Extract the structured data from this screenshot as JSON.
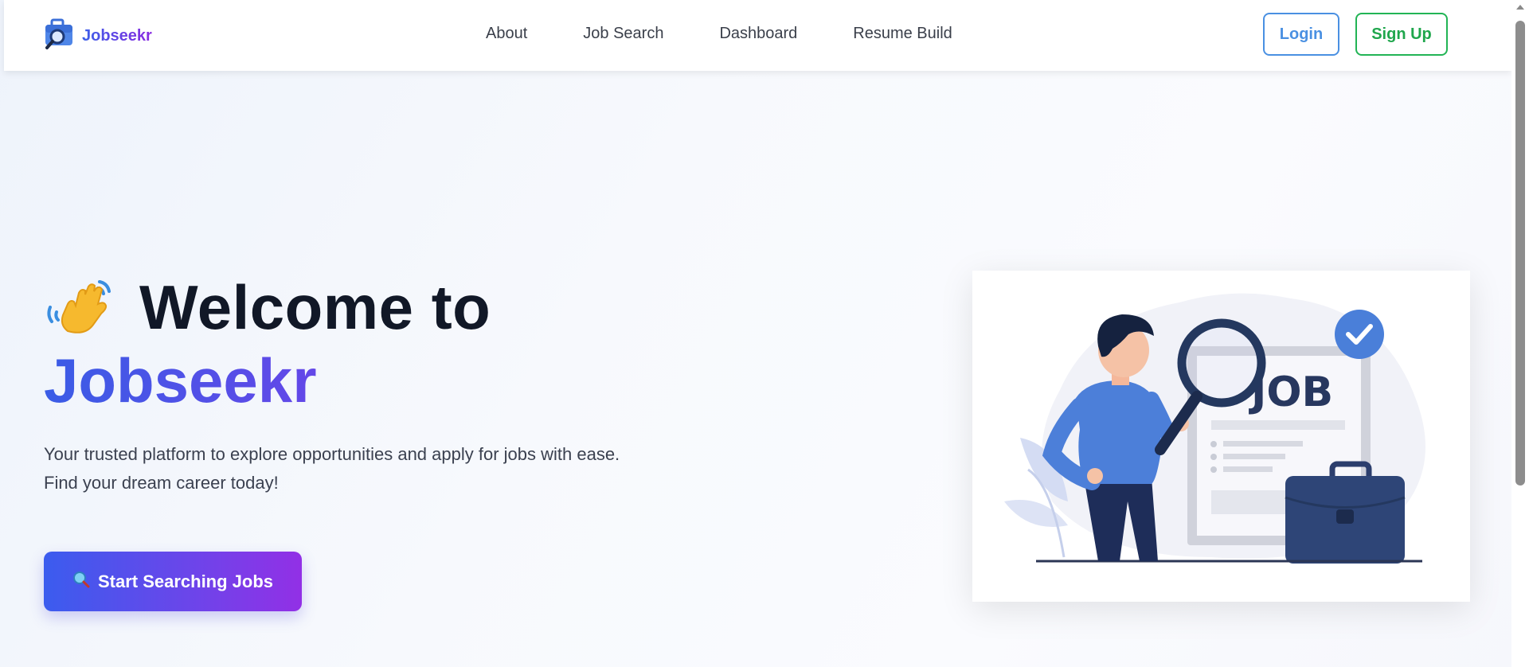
{
  "navbar": {
    "brand": "Jobseekr",
    "brand_icon": "briefcase-search-icon",
    "links": [
      "About",
      "Job Search",
      "Dashboard",
      "Resume Build"
    ],
    "login_label": "Login",
    "signup_label": "Sign Up"
  },
  "hero": {
    "title_prefix": "Welcome to",
    "title_brand": "Jobseekr",
    "wave_icon": "waving-hand-icon",
    "subtitle_line1": "Your trusted platform to explore opportunities and apply for jobs with ease.",
    "subtitle_line2": "Find your dream career today!",
    "cta_label": "Start Searching Jobs",
    "cta_icon": "magnifier-icon"
  },
  "illustration": {
    "word": "JOB"
  },
  "colors": {
    "brand_gradient_start": "#3b5fe8",
    "brand_gradient_end": "#9230e6",
    "login": "#4a90e2",
    "signup": "#22b455",
    "navy": "#27375f"
  }
}
